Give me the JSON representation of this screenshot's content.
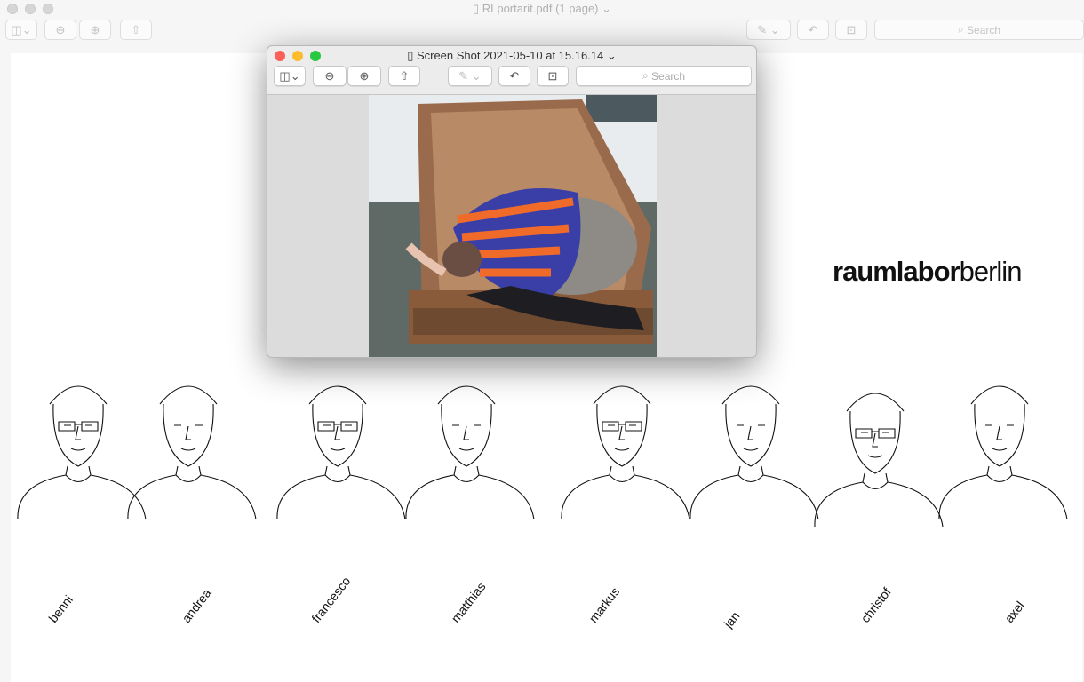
{
  "main_window": {
    "title": "RLportarit.pdf (1 page)",
    "search_placeholder": "Search"
  },
  "document": {
    "logo_bold": "raumlabor",
    "logo_light": "berlin",
    "people": [
      "benni",
      "andrea",
      "francesco",
      "matthias",
      "markus",
      "jan",
      "christof",
      "axel"
    ]
  },
  "popup_window": {
    "title": "Screen Shot 2021-05-10 at 15.16.14",
    "search_placeholder": "Search"
  },
  "icons": [
    "sidebar-icon",
    "zoom-out-icon",
    "zoom-in-icon",
    "share-icon",
    "markup-icon",
    "rotate-icon",
    "toolbox-icon",
    "search-icon"
  ]
}
